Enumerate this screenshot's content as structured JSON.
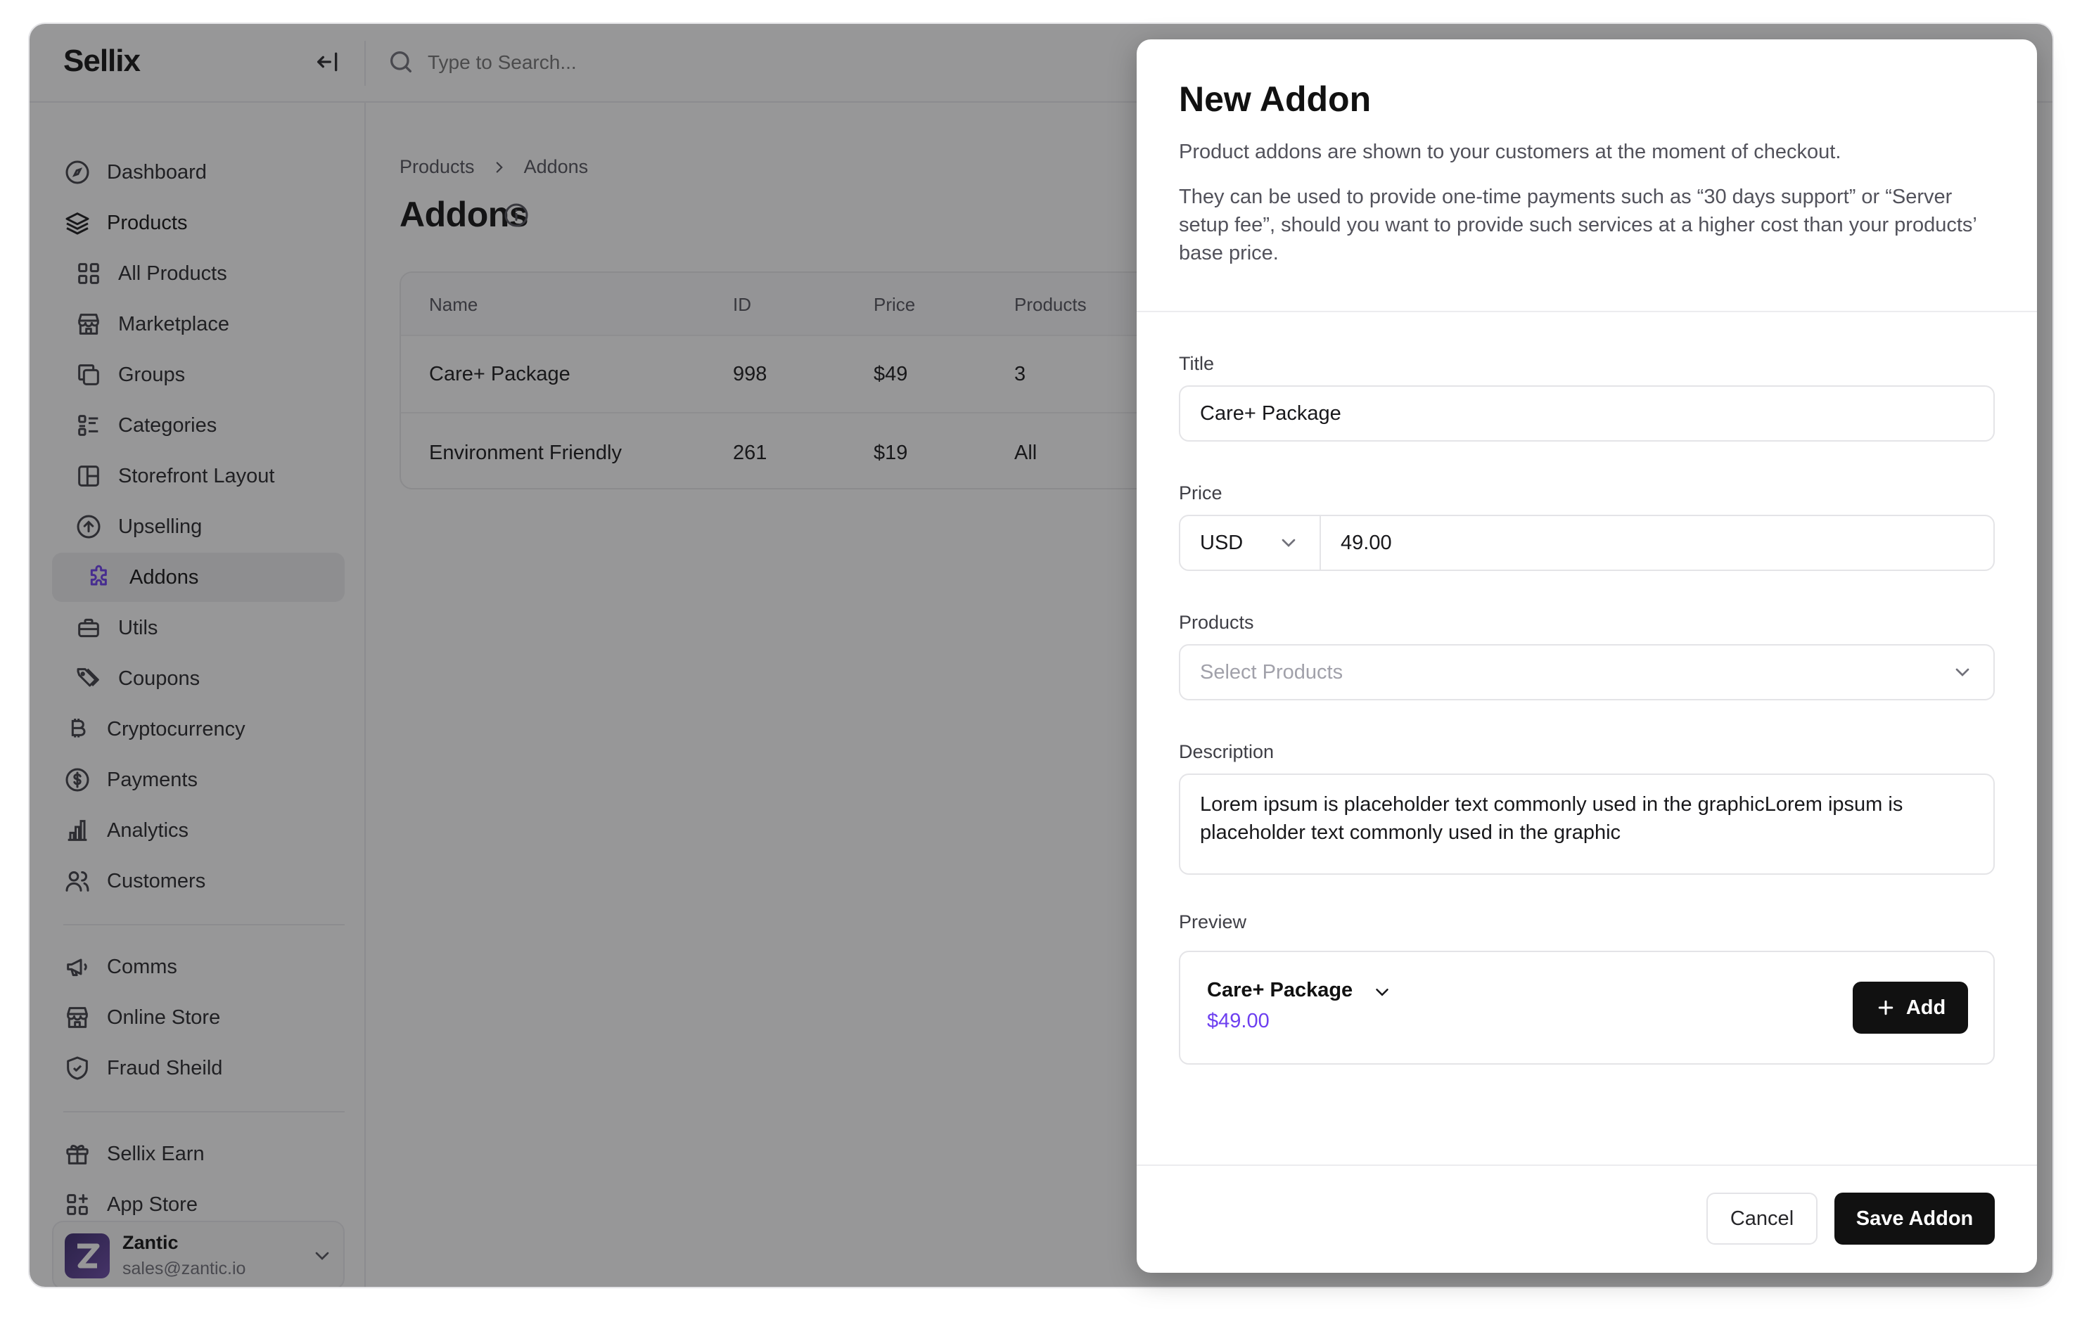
{
  "app": {
    "brand": "Sellix"
  },
  "search": {
    "placeholder": "Type to Search..."
  },
  "sidebar": {
    "items": [
      {
        "label": "Dashboard",
        "icon": "dashboard-icon"
      },
      {
        "label": "Products",
        "icon": "layers-icon"
      },
      {
        "label": "All Products",
        "icon": "grid-icon"
      },
      {
        "label": "Marketplace",
        "icon": "store-icon"
      },
      {
        "label": "Groups",
        "icon": "copy-icon"
      },
      {
        "label": "Categories",
        "icon": "list-icon"
      },
      {
        "label": "Storefront Layout",
        "icon": "layout-icon"
      },
      {
        "label": "Upselling",
        "icon": "arrow-up-circle-icon"
      },
      {
        "label": "Addons",
        "icon": "puzzle-icon"
      },
      {
        "label": "Utils",
        "icon": "briefcase-icon"
      },
      {
        "label": "Coupons",
        "icon": "tag-icon"
      },
      {
        "label": "Cryptocurrency",
        "icon": "bitcoin-icon"
      },
      {
        "label": "Payments",
        "icon": "dollar-circle-icon"
      },
      {
        "label": "Analytics",
        "icon": "bar-chart-icon"
      },
      {
        "label": "Customers",
        "icon": "users-icon"
      },
      {
        "label": "Comms",
        "icon": "megaphone-icon"
      },
      {
        "label": "Online Store",
        "icon": "store-icon"
      },
      {
        "label": "Fraud Sheild",
        "icon": "shield-icon"
      },
      {
        "label": "Sellix Earn",
        "icon": "gift-icon"
      },
      {
        "label": "App Store",
        "icon": "apps-icon"
      }
    ],
    "user": {
      "name": "Zantic",
      "email": "sales@zantic.io"
    },
    "accent": "#6d3ff0"
  },
  "main": {
    "breadcrumb": [
      "Products",
      "Addons"
    ],
    "title": "Addons",
    "table": {
      "columns": [
        "Name",
        "ID",
        "Price",
        "Products"
      ],
      "rows": [
        [
          "Care+ Package",
          "998",
          "$49",
          "3"
        ],
        [
          "Environment Friendly",
          "261",
          "$19",
          "All"
        ]
      ]
    }
  },
  "modal": {
    "title": "New Addon",
    "description1": "Product addons are shown to your customers at the moment of checkout.",
    "description2": "They can be used to provide one-time payments such as “30 days support” or “Server setup fee”, should you want to provide such services at a higher cost than your products’ base price.",
    "fields": {
      "title_label": "Title",
      "title_value": "Care+ Package",
      "price_label": "Price",
      "currency": "USD",
      "price_value": "49.00",
      "products_label": "Products",
      "products_placeholder": "Select Products",
      "description_label": "Description",
      "description_value": "Lorem ipsum is placeholder text commonly used in the graphicLorem ipsum is placeholder text commonly used in the graphic",
      "preview_label": "Preview"
    },
    "preview": {
      "name": "Care+ Package",
      "price": "$49.00",
      "add_label": "Add"
    },
    "buttons": {
      "cancel": "Cancel",
      "save": "Save Addon"
    }
  }
}
